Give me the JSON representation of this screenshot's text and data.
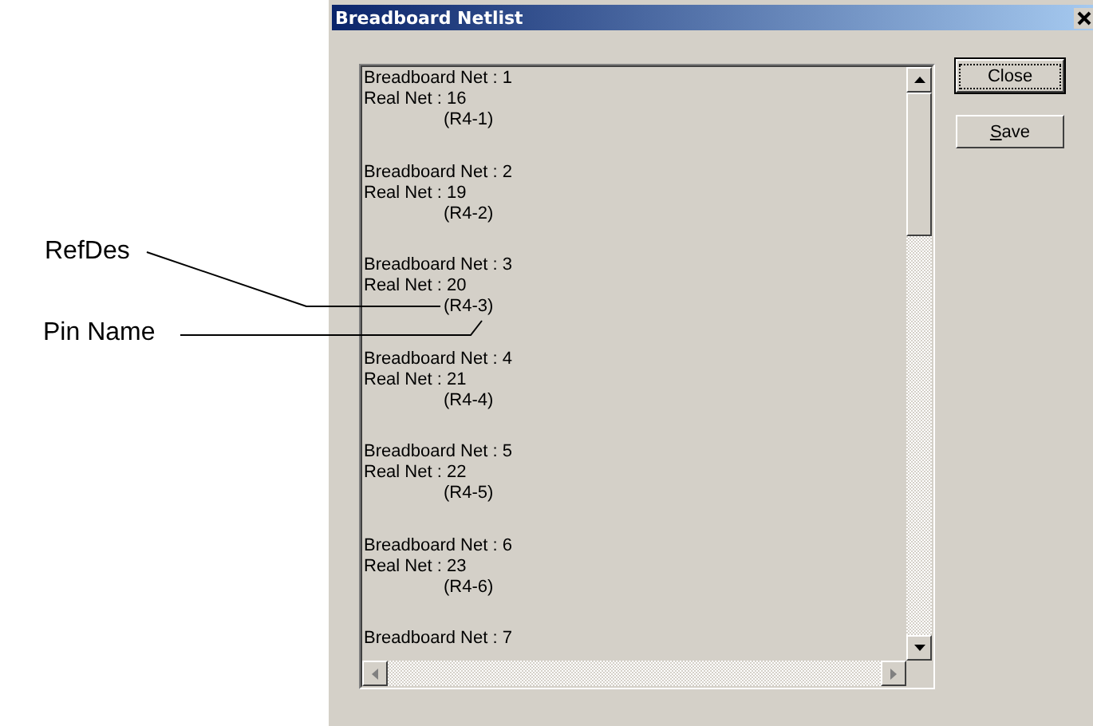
{
  "annotations": [
    {
      "label": "RefDes"
    },
    {
      "label": "Pin Name"
    }
  ],
  "window": {
    "title": "Breadboard Netlist"
  },
  "netlist": [
    {
      "net": "Breadboard Net : 1",
      "real": "Real Net : 16",
      "pin": "(R4-1)"
    },
    {
      "net": "Breadboard Net : 2",
      "real": "Real Net : 19",
      "pin": "(R4-2)"
    },
    {
      "net": "Breadboard Net : 3",
      "real": "Real Net : 20",
      "pin": "(R4-3)"
    },
    {
      "net": "Breadboard Net : 4",
      "real": "Real Net : 21",
      "pin": "(R4-4)"
    },
    {
      "net": "Breadboard Net : 5",
      "real": "Real Net : 22",
      "pin": "(R4-5)"
    },
    {
      "net": "Breadboard Net : 6",
      "real": "Real Net : 23",
      "pin": "(R4-6)"
    },
    {
      "net": "Breadboard Net : 7"
    }
  ],
  "buttons": [
    {
      "label": "Close",
      "focused": true,
      "mnemonic": false
    },
    {
      "label": "Save",
      "focused": false,
      "mnemonic": true
    }
  ]
}
